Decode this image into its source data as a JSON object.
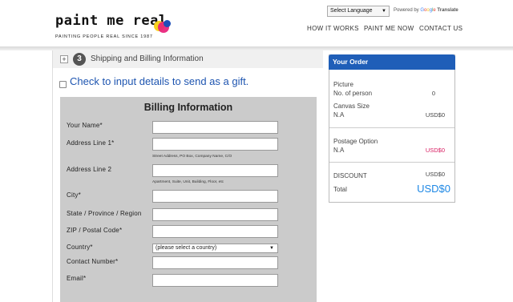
{
  "header": {
    "logo_text": "paint me real",
    "logo_tagline": "PAINTING PEOPLE REAL SINCE 1987",
    "language_select": "Select Language",
    "powered_by": "Powered by",
    "translate_word": "Translate",
    "google_letters": [
      "G",
      "o",
      "o",
      "g",
      "l",
      "e"
    ],
    "nav": [
      "HOW IT WORKS",
      "PAINT ME NOW",
      "CONTACT US"
    ],
    "dot_colors": [
      "#f7d21c",
      "#e8207a",
      "#1e4fb8"
    ]
  },
  "step": {
    "expand_symbol": "+",
    "number": "3",
    "title": "Shipping and Billing Information"
  },
  "gift_label": "Check to input details to send as a gift.",
  "billing": {
    "title": "Billing Information",
    "fields": {
      "name": "Your Name*",
      "address1": "Address Line 1*",
      "address1_help": "Street Address, PO Box, Company Name, C/O",
      "address2": "Address Line 2",
      "address2_help": "Apartment, Suite, Unit, Building, Floor, etc",
      "city": "City*",
      "state": "State / Province / Region",
      "zip": "ZIP / Postal Code*",
      "country": "Country*",
      "country_value": "(please select a country)",
      "contact": "Contact Number*",
      "email": "Email*"
    }
  },
  "order": {
    "title": "Your Order",
    "picture_label": "Picture",
    "persons_label": "No. of person",
    "persons_value": "0",
    "canvas_label": "Canvas Size",
    "canvas_value": "N.A",
    "canvas_price": "USD$0",
    "postage_label": "Postage Option",
    "postage_value": "N.A",
    "postage_price": "USD$0",
    "discount_label": "DISCOUNT",
    "discount_value": "USD$0",
    "total_label": "Total",
    "total_value": "USD$0",
    "accent_color": "#1f5eb8",
    "postage_price_color": "#d81b60"
  }
}
